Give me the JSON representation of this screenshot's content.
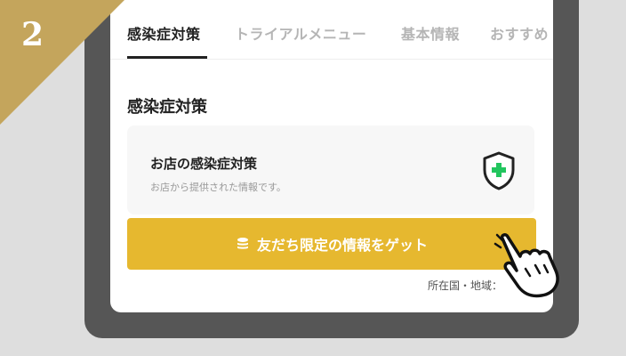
{
  "step_number": "2",
  "tabs": [
    {
      "label": "感染症対策",
      "active": true
    },
    {
      "label": "トライアルメニュー",
      "active": false
    },
    {
      "label": "基本情報",
      "active": false
    },
    {
      "label": "おすすめ",
      "active": false
    }
  ],
  "section_title": "感染症対策",
  "card": {
    "title": "お店の感染症対策",
    "subtitle": "お店から提供された情報です。",
    "icon": "shield-plus-icon"
  },
  "cta": {
    "label": "友だち限定の情報をゲット",
    "icon": "coin-stack-icon"
  },
  "footer_text": "所在国・地域：",
  "colors": {
    "accent": "#e6b82f",
    "badge": "#c4a55c",
    "shield_cross": "#22c55e"
  }
}
